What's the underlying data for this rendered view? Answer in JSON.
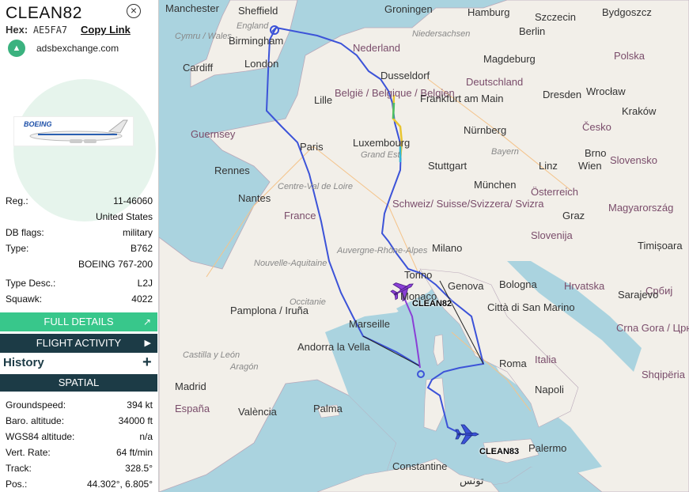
{
  "aircraft": {
    "callsign": "CLEAN82",
    "hex_label": "Hex:",
    "hex": "AE5FA7",
    "copy_link": "Copy Link",
    "source": "adsbexchange.com",
    "photo_text": "BOEING"
  },
  "details": [
    {
      "label": "Reg.:",
      "value": "11-46060"
    },
    {
      "label": "",
      "value": "United States"
    },
    {
      "label": "DB flags:",
      "value": "military"
    },
    {
      "label": "Type:",
      "value": "B762"
    },
    {
      "label": "",
      "value": "BOEING 767-200"
    },
    {
      "label": "Type Desc.:",
      "value": "L2J"
    },
    {
      "label": "Squawk:",
      "value": "4022"
    }
  ],
  "buttons": {
    "full_details": "FULL DETAILS",
    "flight_activity": "FLIGHT ACTIVITY",
    "history": "History",
    "spatial": "SPATIAL"
  },
  "spatial": [
    {
      "label": "Groundspeed:",
      "value": "394 kt"
    },
    {
      "label": "Baro. altitude:",
      "value": "34000 ft"
    },
    {
      "label": "WGS84 altitude:",
      "value": "n/a"
    },
    {
      "label": "Vert. Rate:",
      "value": "64 ft/min"
    },
    {
      "label": "Track:",
      "value": "328.5°"
    },
    {
      "label": "Pos.:",
      "value": "44.302°, 6.805°"
    }
  ],
  "map": {
    "labels": [
      {
        "t": "Manchester",
        "c": "plain"
      },
      {
        "t": "Sheffield",
        "c": "plain"
      },
      {
        "t": "England",
        "c": "region"
      },
      {
        "t": "Birmingham",
        "c": "plain"
      },
      {
        "t": "Cymru / Wales",
        "c": "region"
      },
      {
        "t": "Cardiff",
        "c": "plain"
      },
      {
        "t": "London",
        "c": "plain"
      },
      {
        "t": "Groningen",
        "c": "plain"
      },
      {
        "t": "Hamburg",
        "c": "plain"
      },
      {
        "t": "Szczecin",
        "c": "plain"
      },
      {
        "t": "Bydgoszcz",
        "c": "plain"
      },
      {
        "t": "Nederland",
        "c": "country"
      },
      {
        "t": "Niedersachsen",
        "c": "region"
      },
      {
        "t": "Berlin",
        "c": "plain"
      },
      {
        "t": "Magdeburg",
        "c": "plain"
      },
      {
        "t": "Polska",
        "c": "country"
      },
      {
        "t": "Dusseldorf",
        "c": "plain"
      },
      {
        "t": "Deutschland",
        "c": "country"
      },
      {
        "t": "Dresden",
        "c": "plain"
      },
      {
        "t": "Wrocław",
        "c": "plain"
      },
      {
        "t": "Lille",
        "c": "plain"
      },
      {
        "t": "België / Belgique / Belgien",
        "c": "country"
      },
      {
        "t": "Frankfurt am Main",
        "c": "plain"
      },
      {
        "t": "Kraków",
        "c": "plain"
      },
      {
        "t": "Guernsey",
        "c": "country"
      },
      {
        "t": "Luxembourg",
        "c": "plain"
      },
      {
        "t": "Nürnberg",
        "c": "plain"
      },
      {
        "t": "Česko",
        "c": "country"
      },
      {
        "t": "Paris",
        "c": "plain"
      },
      {
        "t": "Grand Est",
        "c": "region"
      },
      {
        "t": "Bayern",
        "c": "region"
      },
      {
        "t": "Brno",
        "c": "plain"
      },
      {
        "t": "Rennes",
        "c": "plain"
      },
      {
        "t": "Stuttgart",
        "c": "plain"
      },
      {
        "t": "Linz",
        "c": "plain"
      },
      {
        "t": "Wien",
        "c": "plain"
      },
      {
        "t": "Slovensko",
        "c": "country"
      },
      {
        "t": "München",
        "c": "plain"
      },
      {
        "t": "Nantes",
        "c": "plain"
      },
      {
        "t": "Centre-Val de Loire",
        "c": "region"
      },
      {
        "t": "Österreich",
        "c": "country"
      },
      {
        "t": "Schweiz/ Suisse/Svizzera/ Svizra",
        "c": "country"
      },
      {
        "t": "Graz",
        "c": "plain"
      },
      {
        "t": "Magyarország",
        "c": "country"
      },
      {
        "t": "France",
        "c": "country"
      },
      {
        "t": "Slovenija",
        "c": "country"
      },
      {
        "t": "Nouvelle-Aquitaine",
        "c": "region"
      },
      {
        "t": "Auvergne-Rhône-Alpes",
        "c": "region"
      },
      {
        "t": "Milano",
        "c": "plain"
      },
      {
        "t": "Timișoara",
        "c": "plain"
      },
      {
        "t": "Torino",
        "c": "plain"
      },
      {
        "t": "Genova",
        "c": "plain"
      },
      {
        "t": "Bologna",
        "c": "plain"
      },
      {
        "t": "Hrvatska",
        "c": "country"
      },
      {
        "t": "Србиј",
        "c": "country"
      },
      {
        "t": "Sarajevo",
        "c": "plain"
      },
      {
        "t": "Occitanie",
        "c": "region"
      },
      {
        "t": "Monaco",
        "c": "plain"
      },
      {
        "t": "Città di San Marino",
        "c": "plain"
      },
      {
        "t": "Pamplona / Iruña",
        "c": "plain"
      },
      {
        "t": "Marseille",
        "c": "plain"
      },
      {
        "t": "Crna Gora / Црна Гора",
        "c": "country"
      },
      {
        "t": "Andorra la Vella",
        "c": "plain"
      },
      {
        "t": "Castilla y León",
        "c": "region"
      },
      {
        "t": "Aragón",
        "c": "region"
      },
      {
        "t": "Roma",
        "c": "plain"
      },
      {
        "t": "Italia",
        "c": "country"
      },
      {
        "t": "Shqipëria",
        "c": "country"
      },
      {
        "t": "Madrid",
        "c": "plain"
      },
      {
        "t": "Napoli",
        "c": "plain"
      },
      {
        "t": "España",
        "c": "country"
      },
      {
        "t": "València",
        "c": "plain"
      },
      {
        "t": "Palma",
        "c": "plain"
      },
      {
        "t": "Palermo",
        "c": "plain"
      },
      {
        "t": "Constantine",
        "c": "plain"
      },
      {
        "t": "تونس",
        "c": "plain"
      }
    ],
    "aircraft_labels": [
      "CLEAN82",
      "CLEAN83"
    ]
  }
}
